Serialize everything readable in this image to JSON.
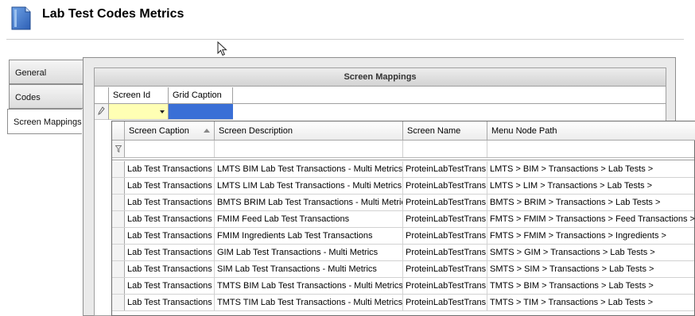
{
  "window": {
    "title": "Lab Test Codes Metrics"
  },
  "tabs": [
    {
      "label": "General"
    },
    {
      "label": "Codes"
    },
    {
      "label": "Screen Mappings"
    }
  ],
  "panel": {
    "title": "Screen Mappings"
  },
  "outer_grid": {
    "columns": [
      "Screen Id",
      "Grid Caption"
    ]
  },
  "popup_grid": {
    "columns": [
      "Screen Caption",
      "Screen Description",
      "Screen Name",
      "Menu Node Path"
    ],
    "sorted_column": "Screen Caption",
    "rows": [
      [
        "Lab Test Transactions",
        "LMTS BIM Lab Test Transactions - Multi Metrics",
        "ProteinLabTestTrans",
        "LMTS > BIM > Transactions > Lab Tests >"
      ],
      [
        "Lab Test Transactions",
        "LMTS LIM Lab Test Transactions - Multi Metrics",
        "ProteinLabTestTrans",
        "LMTS > LIM > Transactions > Lab Tests >"
      ],
      [
        "Lab Test Transactions",
        "BMTS BRIM Lab Test Transactions - Multi Metrics",
        "ProteinLabTestTrans",
        "BMTS > BRIM > Transactions > Lab Tests >"
      ],
      [
        "Lab Test Transactions",
        "FMIM Feed Lab Test Transactions",
        "ProteinLabTestTrans",
        "FMTS > FMIM > Transactions > Feed Transactions >"
      ],
      [
        "Lab Test Transactions",
        "FMIM Ingredients Lab Test Transactions",
        "ProteinLabTestTrans",
        "FMTS > FMIM > Transactions > Ingredients >"
      ],
      [
        "Lab Test Transactions",
        "GIM Lab Test Transactions - Multi Metrics",
        "ProteinLabTestTrans",
        "SMTS > GIM > Transactions > Lab Tests >"
      ],
      [
        "Lab Test Transactions",
        "SIM Lab Test Transactions - Multi Metrics",
        "ProteinLabTestTrans",
        "SMTS > SIM > Transactions > Lab Tests >"
      ],
      [
        "Lab Test Transactions",
        "TMTS BIM Lab Test Transactions - Multi Metrics",
        "ProteinLabTestTrans",
        "TMTS > BIM > Transactions > Lab Tests >"
      ],
      [
        "Lab Test Transactions",
        "TMTS TIM Lab Test Transactions - Multi Metrics",
        "ProteinLabTestTrans",
        "TMTS > TIM > Transactions > Lab Tests >"
      ]
    ]
  },
  "icons": {
    "header": "document-icon",
    "row_indicator": "pencil-icon",
    "filter": "funnel-icon",
    "cursor": "mouse-pointer-icon"
  },
  "colors": {
    "selected_cell": "#3a6fd6",
    "editing_cell": "#ffffb4"
  }
}
